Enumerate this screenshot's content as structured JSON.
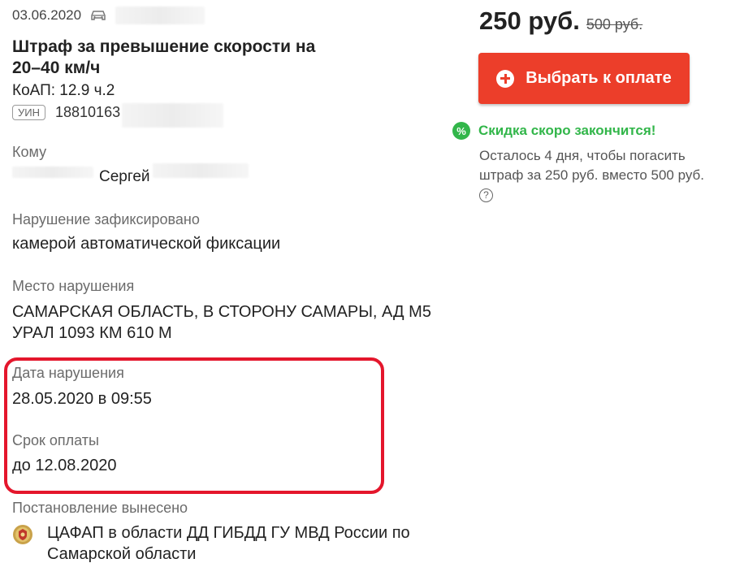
{
  "fine": {
    "date": "03.06.2020",
    "title": "Штраф за превышение скорости на 20–40 км/ч",
    "koap": "КоАП: 12.9 ч.2",
    "uin_badge": "УИН",
    "uin_value": "18810163"
  },
  "recipient": {
    "label": "Кому",
    "name": "Сергей"
  },
  "recorded": {
    "label": "Нарушение зафиксировано",
    "value": "камерой автоматической фиксации"
  },
  "place": {
    "label": "Место нарушения",
    "value": "САМАРСКАЯ ОБЛАСТЬ, В СТОРОНУ САМАРЫ, АД М5 УРАЛ 1093 КМ 610 М"
  },
  "violation_date": {
    "label": "Дата нарушения",
    "value": "28.05.2020 в 09:55"
  },
  "payment_deadline": {
    "label": "Срок оплаты",
    "value": "до 12.08.2020"
  },
  "issued_by": {
    "label": "Постановление вынесено",
    "value": "ЦАФАП в области ДД ГИБДД ГУ МВД России по Самарской области"
  },
  "price": {
    "current": "250 руб.",
    "old": "500 руб."
  },
  "pay_button": {
    "label": "Выбрать к оплате"
  },
  "discount": {
    "title": "Скидка скоро закончится!",
    "description": "Осталось 4 дня, чтобы погасить штраф за 250 руб. вместо 500 руб.",
    "help": "?"
  },
  "icons": {
    "car": "car-icon",
    "plus": "plus-circle-icon",
    "percent": "percent-icon",
    "help": "question-icon",
    "emblem": "police-emblem-icon"
  },
  "colors": {
    "accent_red": "#ec3e2a",
    "discount_green": "#32b64a",
    "highlight_red": "#e4162c"
  }
}
